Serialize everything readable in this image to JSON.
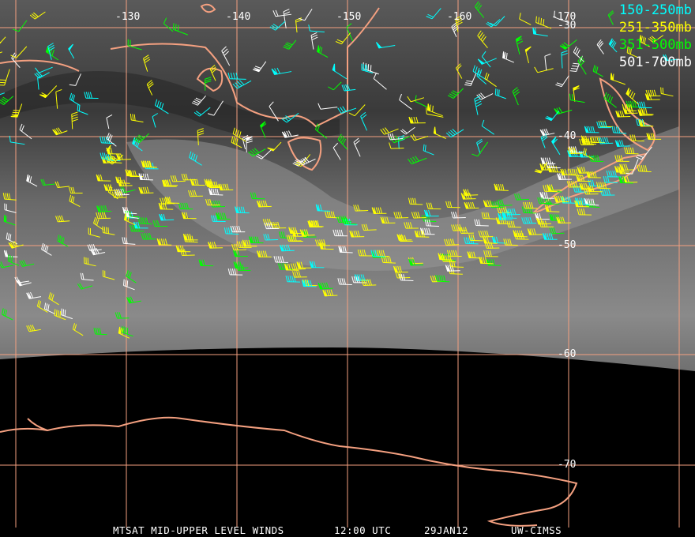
{
  "legend": [
    {
      "label": "150-250mb",
      "color": "#00ffff"
    },
    {
      "label": "251-350mb",
      "color": "#ffff00"
    },
    {
      "label": "351-500mb",
      "color": "#00ff00"
    },
    {
      "label": "501-700mb",
      "color": "#ffffff"
    }
  ],
  "longitude_labels": [
    "-130",
    "-140",
    "-150",
    "-160",
    "-170"
  ],
  "latitude_labels": [
    "-30",
    "-40",
    "-50",
    "-60",
    "-70"
  ],
  "caption": {
    "product": "MTSAT MID-UPPER LEVEL WINDS",
    "time": "12:00 UTC",
    "date": "29JAN12",
    "source": "UW-CIMSS"
  },
  "colors": {
    "grid": "#f4a080",
    "coast": "#f4a080"
  }
}
